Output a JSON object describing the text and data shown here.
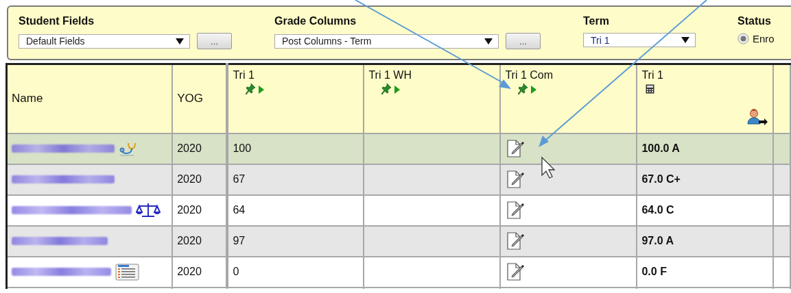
{
  "filters": [
    {
      "kind": "select-more",
      "label": "Student Fields",
      "value": "Default Fields",
      "more": "..."
    },
    {
      "kind": "select-more",
      "label": "Grade Columns",
      "value": "Post Columns - Term",
      "more": "..."
    },
    {
      "kind": "select",
      "label": "Term",
      "value": "Tri 1"
    },
    {
      "kind": "radio",
      "label": "Status",
      "option": "Enro",
      "checked": true
    }
  ],
  "table": {
    "columns": [
      {
        "kind": "name",
        "label": "Name"
      },
      {
        "kind": "plain",
        "label": "YOG"
      },
      {
        "kind": "post",
        "label": "Tri 1"
      },
      {
        "kind": "post",
        "label": "Tri 1 WH"
      },
      {
        "kind": "post",
        "label": "Tri 1 Com"
      },
      {
        "kind": "average",
        "label": "Tri 1"
      }
    ],
    "rows": [
      {
        "selected": true,
        "kind": "medical",
        "yog": "2020",
        "score": "100",
        "average": "100.0 A"
      },
      {
        "selected": false,
        "kind": "plain",
        "yog": "2020",
        "score": "67",
        "average": "67.0 C+"
      },
      {
        "selected": false,
        "kind": "legal",
        "yog": "2020",
        "score": "64",
        "average": "64.0 C"
      },
      {
        "selected": false,
        "kind": "plain",
        "yog": "2020",
        "score": "97",
        "average": "97.0 A"
      },
      {
        "selected": false,
        "kind": "notes",
        "yog": "2020",
        "score": "0",
        "average": "0.0 F"
      }
    ]
  }
}
